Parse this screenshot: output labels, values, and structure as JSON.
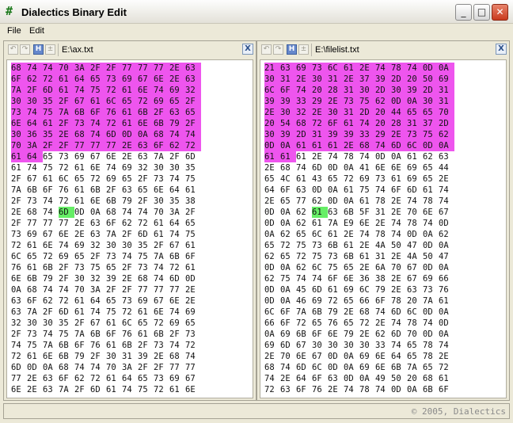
{
  "window": {
    "title": "Dialectics Binary Edit",
    "minimize": "_",
    "maximize": "□",
    "close": "✕"
  },
  "menu": {
    "file": "File",
    "edit": "Edit"
  },
  "panels": [
    {
      "path": "E:\\ax.txt",
      "close_label": "X",
      "toolbar": {
        "h_label": "H",
        "pm_label": "±"
      },
      "rows": [
        [
          "68",
          "74",
          "74",
          "70",
          "3A",
          "2F",
          "2F",
          "77",
          "77",
          "77",
          "2E",
          "63"
        ],
        [
          "6F",
          "62",
          "72",
          "61",
          "64",
          "65",
          "73",
          "69",
          "67",
          "6E",
          "2E",
          "63"
        ],
        [
          "7A",
          "2F",
          "6D",
          "61",
          "74",
          "75",
          "72",
          "61",
          "6E",
          "74",
          "69",
          "32"
        ],
        [
          "30",
          "30",
          "35",
          "2F",
          "67",
          "61",
          "6C",
          "65",
          "72",
          "69",
          "65",
          "2F"
        ],
        [
          "73",
          "74",
          "75",
          "7A",
          "6B",
          "6F",
          "76",
          "61",
          "6B",
          "2F",
          "63",
          "65"
        ],
        [
          "6E",
          "64",
          "61",
          "2F",
          "73",
          "74",
          "72",
          "61",
          "6E",
          "6B",
          "79",
          "2F"
        ],
        [
          "30",
          "36",
          "35",
          "2E",
          "68",
          "74",
          "6D",
          "0D",
          "0A",
          "68",
          "74",
          "74"
        ],
        [
          "70",
          "3A",
          "2F",
          "2F",
          "77",
          "77",
          "77",
          "2E",
          "63",
          "6F",
          "62",
          "72"
        ],
        [
          "61",
          "64",
          "65",
          "73",
          "69",
          "67",
          "6E",
          "2E",
          "63",
          "7A",
          "2F",
          "6D"
        ],
        [
          "61",
          "74",
          "75",
          "72",
          "61",
          "6E",
          "74",
          "69",
          "32",
          "30",
          "30",
          "35"
        ],
        [
          "2F",
          "67",
          "61",
          "6C",
          "65",
          "72",
          "69",
          "65",
          "2F",
          "73",
          "74",
          "75"
        ],
        [
          "7A",
          "6B",
          "6F",
          "76",
          "61",
          "6B",
          "2F",
          "63",
          "65",
          "6E",
          "64",
          "61"
        ],
        [
          "2F",
          "73",
          "74",
          "72",
          "61",
          "6E",
          "6B",
          "79",
          "2F",
          "30",
          "35",
          "38"
        ],
        [
          "2E",
          "68",
          "74",
          "6D",
          "0D",
          "0A",
          "68",
          "74",
          "74",
          "70",
          "3A",
          "2F"
        ],
        [
          "2F",
          "77",
          "77",
          "77",
          "2E",
          "63",
          "6F",
          "62",
          "72",
          "61",
          "64",
          "65"
        ],
        [
          "73",
          "69",
          "67",
          "6E",
          "2E",
          "63",
          "7A",
          "2F",
          "6D",
          "61",
          "74",
          "75"
        ],
        [
          "72",
          "61",
          "6E",
          "74",
          "69",
          "32",
          "30",
          "30",
          "35",
          "2F",
          "67",
          "61"
        ],
        [
          "6C",
          "65",
          "72",
          "69",
          "65",
          "2F",
          "73",
          "74",
          "75",
          "7A",
          "6B",
          "6F"
        ],
        [
          "76",
          "61",
          "6B",
          "2F",
          "73",
          "75",
          "65",
          "2F",
          "73",
          "74",
          "72",
          "61"
        ],
        [
          "6E",
          "6B",
          "79",
          "2F",
          "30",
          "32",
          "39",
          "2E",
          "68",
          "74",
          "6D",
          "0D"
        ],
        [
          "0A",
          "68",
          "74",
          "74",
          "70",
          "3A",
          "2F",
          "2F",
          "77",
          "77",
          "77",
          "2E"
        ],
        [
          "63",
          "6F",
          "62",
          "72",
          "61",
          "64",
          "65",
          "73",
          "69",
          "67",
          "6E",
          "2E"
        ],
        [
          "63",
          "7A",
          "2F",
          "6D",
          "61",
          "74",
          "75",
          "72",
          "61",
          "6E",
          "74",
          "69"
        ],
        [
          "32",
          "30",
          "30",
          "35",
          "2F",
          "67",
          "61",
          "6C",
          "65",
          "72",
          "69",
          "65"
        ],
        [
          "2F",
          "73",
          "74",
          "75",
          "7A",
          "6B",
          "6F",
          "76",
          "61",
          "6B",
          "2F",
          "73"
        ],
        [
          "74",
          "75",
          "7A",
          "6B",
          "6F",
          "76",
          "61",
          "6B",
          "2F",
          "73",
          "74",
          "72"
        ],
        [
          "72",
          "61",
          "6E",
          "6B",
          "79",
          "2F",
          "30",
          "31",
          "39",
          "2E",
          "68",
          "74"
        ],
        [
          "6D",
          "0D",
          "0A",
          "68",
          "74",
          "74",
          "70",
          "3A",
          "2F",
          "2F",
          "77",
          "77"
        ],
        [
          "77",
          "2E",
          "63",
          "6F",
          "62",
          "72",
          "61",
          "64",
          "65",
          "73",
          "69",
          "67"
        ],
        [
          "6E",
          "2E",
          "63",
          "7A",
          "2F",
          "6D",
          "61",
          "74",
          "75",
          "72",
          "61",
          "6E"
        ]
      ],
      "selected_cell_count": 98,
      "cursor_cell": [
        13,
        3
      ]
    },
    {
      "path": "E:\\filelist.txt",
      "close_label": "X",
      "toolbar": {
        "h_label": "H",
        "pm_label": "±"
      },
      "rows": [
        [
          "21",
          "63",
          "69",
          "73",
          "6C",
          "61",
          "2E",
          "74",
          "78",
          "74",
          "0D",
          "0A"
        ],
        [
          "30",
          "31",
          "2E",
          "30",
          "31",
          "2E",
          "37",
          "39",
          "2D",
          "20",
          "50",
          "69"
        ],
        [
          "6C",
          "6F",
          "74",
          "20",
          "28",
          "31",
          "30",
          "2D",
          "30",
          "39",
          "2D",
          "31"
        ],
        [
          "39",
          "39",
          "33",
          "29",
          "2E",
          "73",
          "75",
          "62",
          "0D",
          "0A",
          "30",
          "31"
        ],
        [
          "2E",
          "30",
          "32",
          "2E",
          "30",
          "31",
          "2D",
          "20",
          "44",
          "65",
          "65",
          "70"
        ],
        [
          "20",
          "54",
          "68",
          "72",
          "6F",
          "61",
          "74",
          "20",
          "28",
          "31",
          "37",
          "2D"
        ],
        [
          "30",
          "39",
          "2D",
          "31",
          "39",
          "39",
          "33",
          "29",
          "2E",
          "73",
          "75",
          "62"
        ],
        [
          "0D",
          "0A",
          "61",
          "61",
          "61",
          "2E",
          "68",
          "74",
          "6D",
          "6C",
          "0D",
          "0A"
        ],
        [
          "61",
          "61",
          "61",
          "2E",
          "74",
          "78",
          "74",
          "0D",
          "0A",
          "61",
          "62",
          "63"
        ],
        [
          "2E",
          "68",
          "74",
          "6D",
          "0D",
          "0A",
          "41",
          "6E",
          "6E",
          "69",
          "65",
          "44"
        ],
        [
          "65",
          "4C",
          "61",
          "43",
          "65",
          "72",
          "69",
          "73",
          "61",
          "69",
          "65",
          "2E"
        ],
        [
          "64",
          "6F",
          "63",
          "0D",
          "0A",
          "61",
          "75",
          "74",
          "6F",
          "6D",
          "61",
          "74"
        ],
        [
          "2E",
          "65",
          "77",
          "62",
          "0D",
          "0A",
          "61",
          "78",
          "2E",
          "74",
          "78",
          "74"
        ],
        [
          "0D",
          "0A",
          "62",
          "61",
          "63",
          "6B",
          "5F",
          "31",
          "2E",
          "70",
          "6E",
          "67"
        ],
        [
          "0D",
          "0A",
          "62",
          "61",
          "7A",
          "E9",
          "6E",
          "2E",
          "74",
          "78",
          "74",
          "0D"
        ],
        [
          "0A",
          "62",
          "65",
          "6C",
          "61",
          "2E",
          "74",
          "78",
          "74",
          "0D",
          "0A",
          "62"
        ],
        [
          "65",
          "72",
          "75",
          "73",
          "6B",
          "61",
          "2E",
          "4A",
          "50",
          "47",
          "0D",
          "0A"
        ],
        [
          "62",
          "65",
          "72",
          "75",
          "73",
          "6B",
          "61",
          "31",
          "2E",
          "4A",
          "50",
          "47"
        ],
        [
          "0D",
          "0A",
          "62",
          "6C",
          "75",
          "65",
          "2E",
          "6A",
          "70",
          "67",
          "0D",
          "0A"
        ],
        [
          "62",
          "75",
          "74",
          "74",
          "6F",
          "6E",
          "36",
          "38",
          "2E",
          "67",
          "69",
          "66"
        ],
        [
          "0D",
          "0A",
          "45",
          "6D",
          "61",
          "69",
          "6C",
          "79",
          "2E",
          "63",
          "73",
          "76"
        ],
        [
          "0D",
          "0A",
          "46",
          "69",
          "72",
          "65",
          "66",
          "6F",
          "78",
          "20",
          "7A",
          "61"
        ],
        [
          "6C",
          "6F",
          "7A",
          "6B",
          "79",
          "2E",
          "68",
          "74",
          "6D",
          "6C",
          "0D",
          "0A"
        ],
        [
          "66",
          "6F",
          "72",
          "65",
          "76",
          "65",
          "72",
          "2E",
          "74",
          "78",
          "74",
          "0D"
        ],
        [
          "0A",
          "69",
          "6B",
          "6F",
          "6E",
          "79",
          "2E",
          "62",
          "6D",
          "70",
          "0D",
          "0A"
        ],
        [
          "69",
          "6D",
          "67",
          "30",
          "30",
          "30",
          "30",
          "33",
          "74",
          "65",
          "78",
          "74"
        ],
        [
          "2E",
          "70",
          "6E",
          "67",
          "0D",
          "0A",
          "69",
          "6E",
          "64",
          "65",
          "78",
          "2E"
        ],
        [
          "68",
          "74",
          "6D",
          "6C",
          "0D",
          "0A",
          "69",
          "6E",
          "6B",
          "7A",
          "65",
          "72"
        ],
        [
          "74",
          "2E",
          "64",
          "6F",
          "63",
          "0D",
          "0A",
          "49",
          "50",
          "20",
          "68",
          "61"
        ],
        [
          "72",
          "63",
          "6F",
          "76",
          "2E",
          "74",
          "78",
          "74",
          "0D",
          "0A",
          "6B",
          "6F"
        ]
      ],
      "selected_cell_count": 98,
      "cursor_cell": [
        13,
        3
      ]
    }
  ],
  "status": {
    "copyright": "© 2005, Dialectics"
  },
  "colors": {
    "selection": "#ee55ee",
    "cursor": "#66ee66"
  }
}
